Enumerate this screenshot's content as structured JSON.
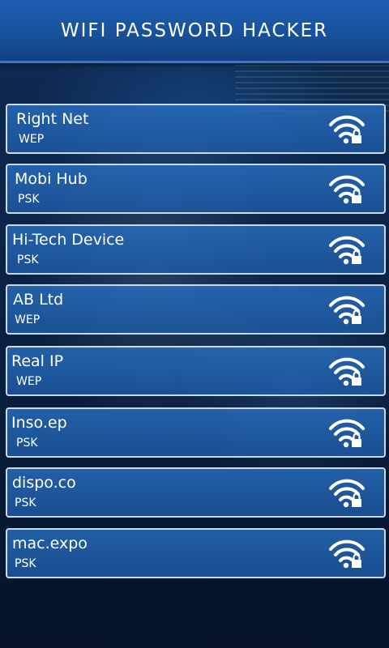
{
  "header": {
    "title": "WIFI PASSWORD HACKER"
  },
  "networks": [
    {
      "name": "Right Net",
      "security": "WEP",
      "icon": "wifi-lock-icon"
    },
    {
      "name": "Mobi Hub",
      "security": "PSK",
      "icon": "wifi-lock-icon"
    },
    {
      "name": "Hi-Tech Device",
      "security": "PSK",
      "icon": "wifi-lock-icon"
    },
    {
      "name": "AB Ltd",
      "security": "WEP",
      "icon": "wifi-lock-icon"
    },
    {
      "name": "Real IP",
      "security": "WEP",
      "icon": "wifi-lock-icon"
    },
    {
      "name": "Inso.ep",
      "security": "PSK",
      "icon": "wifi-lock-icon"
    },
    {
      "name": "dispo.co",
      "security": "PSK",
      "icon": "wifi-lock-icon"
    },
    {
      "name": "mac.expo",
      "security": "PSK",
      "icon": "wifi-lock-icon"
    }
  ],
  "colors": {
    "header": "#1a58a6",
    "item": "#2a6fbe",
    "border": "#c9d9ec",
    "text": "#ffffff"
  }
}
